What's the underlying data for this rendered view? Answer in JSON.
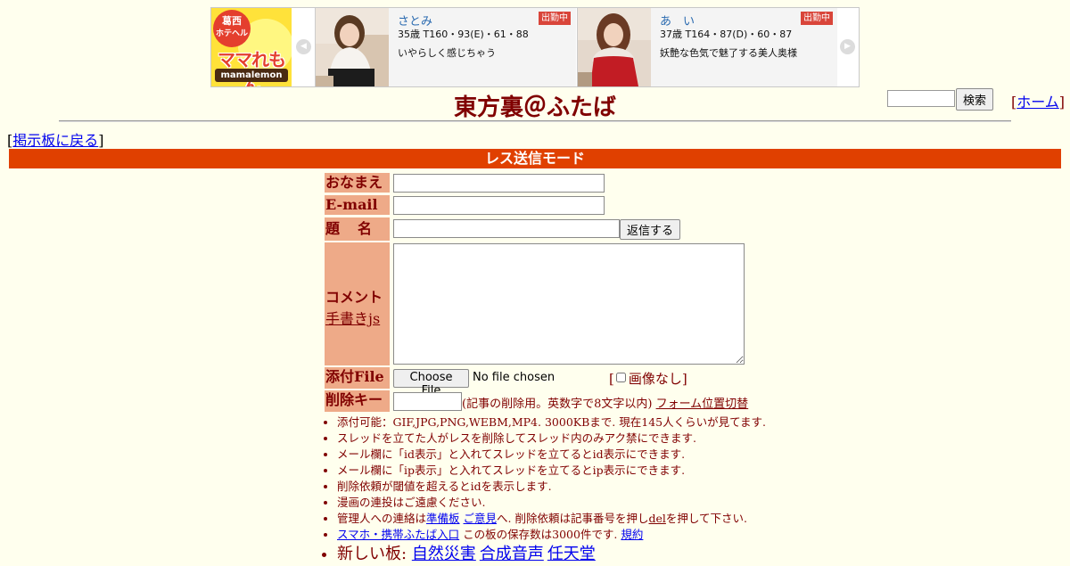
{
  "banner": {
    "logo": {
      "area": "葛西",
      "kind": "ホテヘル",
      "main": "ママれもん",
      "sub": "mamalemon"
    },
    "cards": [
      {
        "name": "さとみ",
        "badge": "出勤中",
        "stats": "35歳 T160・93(E)・61・88",
        "desc": "いやらしく感じちゃう"
      },
      {
        "name": "あ　い",
        "badge": "出勤中",
        "stats": "37歳 T164・87(D)・60・87",
        "desc": "妖艶な色気で魅了する美人奥様"
      }
    ],
    "prev_glyph": "◀",
    "next_glyph": "▶"
  },
  "header": {
    "title": "東方裏＠ふたば",
    "search_placeholder": "",
    "search_button": "検索",
    "home_link": "ホーム"
  },
  "nav": {
    "back_link": "掲示板に戻る"
  },
  "mode": {
    "label": "レス送信モード"
  },
  "form": {
    "name_label": "おなまえ",
    "email_label": "E-mail",
    "subject_label": "題　名",
    "submit_button": "返信する",
    "comment_label": "コメント",
    "handwriting_link": "手書きjs",
    "file_label": "添付File",
    "file_button": "Choose File",
    "file_status": "No file chosen",
    "noimage_label": "画像なし",
    "delkey_label": "削除キー",
    "delkey_note": "(記事の削除用。英数字で8文字以内)",
    "form_position_link": "フォーム位置切替"
  },
  "notes": {
    "n1": "添付可能：GIF,JPG,PNG,WEBM,MP4. 3000KBまで. 現在145人くらいが見てます.",
    "n2": "スレッドを立てた人がレスを削除してスレッド内のみアク禁にできます.",
    "n3": "メール欄に「id表示」と入れてスレッドを立てるとid表示にできます.",
    "n4": "メール欄に「ip表示」と入れてスレッドを立てるとip表示にできます.",
    "n5": "削除依頼が閾値を超えるとidを表示します.",
    "n6": "漫画の連投はご遠慮ください.",
    "n7_pre": "管理人への連絡は",
    "n7_link1": "準備板",
    "n7_link2": "ご意見",
    "n7_mid": "へ. 削除依頼は記事番号を押し",
    "n7_link3": "del",
    "n7_post": "を押して下さい.",
    "n8_link": "スマホ・携帯ふたば入口",
    "n8_mid": " この板の保存数は3000件です.",
    "n8_link2": "規約",
    "n9_label": "新しい板:",
    "n9_links": [
      "自然災害",
      "合成音声",
      "任天堂"
    ]
  },
  "colors": {
    "text": "#800000",
    "background": "#ffffee",
    "mode_bar": "#e04000",
    "label_bg": "#eeaa88",
    "link": "#0000ee"
  }
}
